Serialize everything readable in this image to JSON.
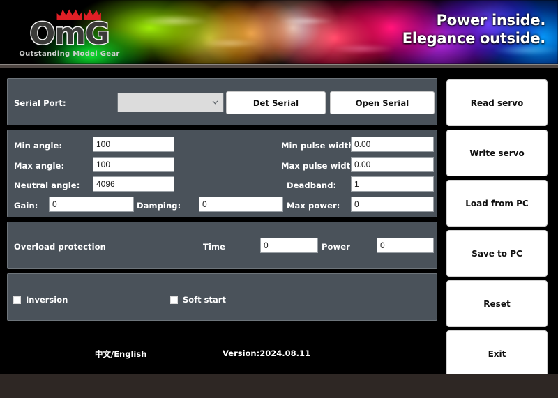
{
  "banner": {
    "logo_text": "OmG",
    "logo_subtitle": "Outstanding Model Gear",
    "crown_icon": "crown-icon",
    "tagline_line1": "Power inside.",
    "tagline_line2": "Elegance outside."
  },
  "serial": {
    "label": "Serial Port:",
    "port_value": "",
    "port_placeholder": "",
    "dropdown_icon": "chevron-down-icon",
    "detect_button": "Det Serial",
    "open_button": "Open Serial"
  },
  "params": {
    "min_angle": {
      "label": "Min angle:",
      "value": "100"
    },
    "max_angle": {
      "label": "Max angle:",
      "value": "100"
    },
    "neutral_angle": {
      "label": "Neutral angle:",
      "value": "4096"
    },
    "gain": {
      "label": "Gain:",
      "value": "0"
    },
    "damping": {
      "label": "Damping:",
      "value": "0"
    },
    "min_pulse_width": {
      "label": "Min pulse width:",
      "value": "0.00"
    },
    "max_pulse_width": {
      "label": "Max pulse width:",
      "value": "0.00"
    },
    "deadband": {
      "label": "Deadband:",
      "value": "1"
    },
    "max_power": {
      "label": "Max power:",
      "value": "0"
    }
  },
  "overload": {
    "title": "Overload protection",
    "time": {
      "label": "Time",
      "value": "0"
    },
    "power": {
      "label": "Power",
      "value": "0"
    }
  },
  "options": {
    "inversion": {
      "label": "Inversion",
      "checked": false
    },
    "soft_start": {
      "label": "Soft start",
      "checked": false
    }
  },
  "actions": [
    {
      "label": "Read servo"
    },
    {
      "label": "Write servo"
    },
    {
      "label": "Load from PC"
    },
    {
      "label": "Save to PC"
    },
    {
      "label": "Reset"
    },
    {
      "label": "Exit"
    }
  ],
  "footer": {
    "language": "中文/English",
    "version": "Version:2024.08.11"
  },
  "colors": {
    "panel": "#4a525a",
    "panel_border": "#6d747a",
    "background": "#000000",
    "frame": "#2e2724",
    "button": "#ffffff",
    "text_light": "#ffffff",
    "dropdown": "#dcdcdc"
  }
}
